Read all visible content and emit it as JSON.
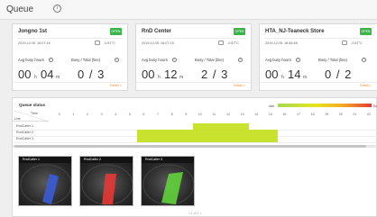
{
  "header": {
    "title": "Queue"
  },
  "cards": [
    {
      "name": "Jongno 1st",
      "badge": "OPEN",
      "date": "2019-12-05",
      "time": "16:07:16",
      "temp": "-0.67°C",
      "avg_label": "Avg busy hours",
      "busy_label": "Busy / Total (line)",
      "hours": "00",
      "h_unit": "h",
      "minutes": "04",
      "m_unit": "m",
      "busy_total": "0 / 3",
      "detail": "Detail >"
    },
    {
      "name": "RnD Center",
      "badge": "OPEN",
      "date": "2019-12-05",
      "time": "16:07:15",
      "temp": "-0.67°C",
      "avg_label": "Avg busy hours",
      "busy_label": "Busy / Total (line)",
      "hours": "00",
      "h_unit": "h",
      "minutes": "12",
      "m_unit": "m",
      "busy_total": "2 / 3",
      "detail": "Detail >"
    },
    {
      "name": "HTA_NJ-Teaneck Store",
      "badge": "OPEN",
      "date": "2019-12-05",
      "time": "16:56:46",
      "temp": "-0.67°C",
      "avg_label": "Avg busy hours",
      "busy_label": "Busy / Total (line)",
      "hours": "00",
      "h_unit": "h",
      "minutes": "14",
      "m_unit": "m",
      "busy_total": "0 / 2",
      "detail": "Detail >"
    }
  ],
  "queue_status": {
    "title": "Queue status",
    "legend_idle": "idle",
    "legend_busy": "Bu",
    "time_label": "Time",
    "line_label": "Line",
    "hours": [
      "0",
      "1",
      "2",
      "3",
      "4",
      "5",
      "6",
      "7",
      "8",
      "9",
      "10",
      "11",
      "12",
      "13",
      "14",
      "15",
      "16",
      "17",
      "18",
      "19",
      "20",
      "21",
      "22"
    ],
    "rows": [
      "RndCaller 1",
      "RndCaller 2",
      "RndCaller 3"
    ],
    "busy_cells": [
      {
        "row": 0,
        "from": 10,
        "to": 14
      },
      {
        "row": 1,
        "from": 6,
        "to": 16
      },
      {
        "row": 2,
        "from": 6,
        "to": 16
      }
    ],
    "cameras": [
      {
        "label": "RndCaller 1",
        "zone_color": "#3b5bd6"
      },
      {
        "label": "RndCaller 2",
        "zone_color": "#e53935"
      },
      {
        "label": "RndCaller 3",
        "zone_color": "#5fd13a"
      }
    ],
    "pager": "< 1 of 1 >"
  },
  "colors": {
    "open_badge": "#3cb44b",
    "busy_cell": "#c9e22f",
    "detail_link": "#f08c2c"
  }
}
